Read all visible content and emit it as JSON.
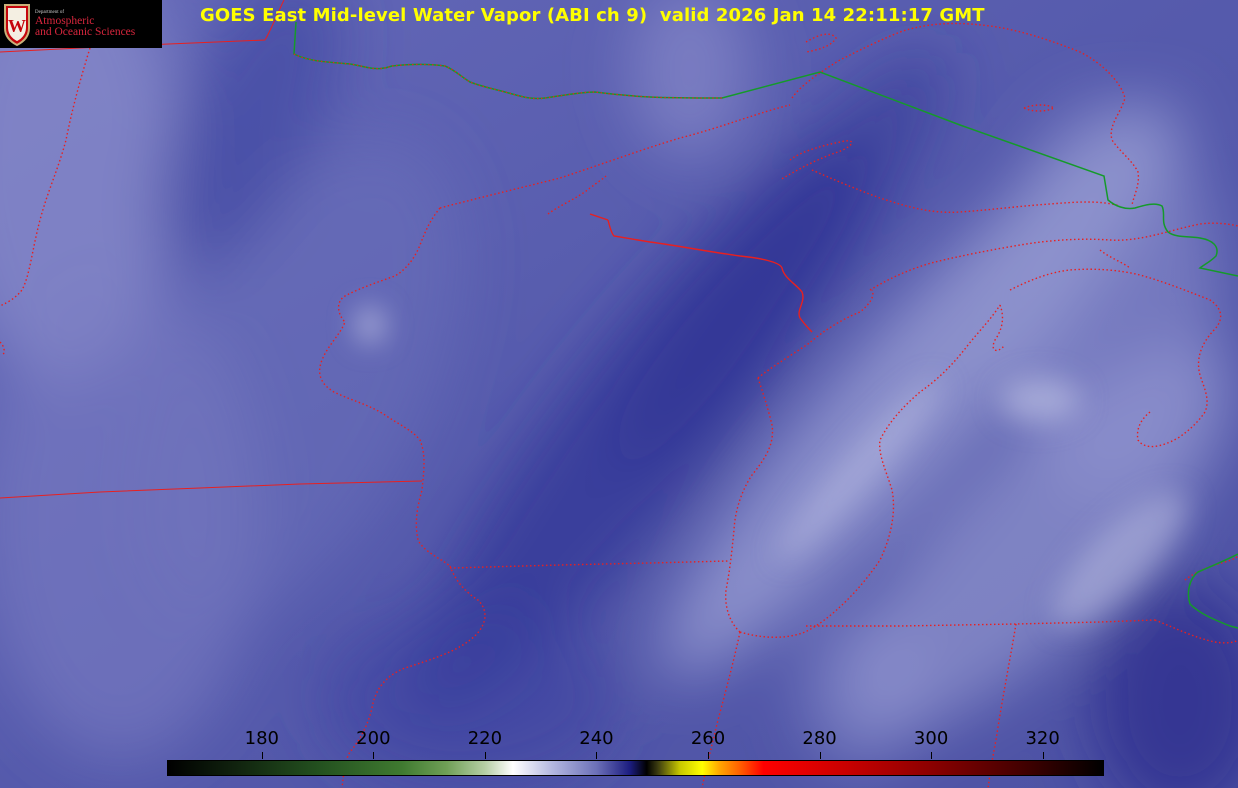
{
  "title": "GOES East Mid-level Water Vapor (ABI ch 9)  valid 2026 Jan 14 22:11:17 GMT",
  "logo": {
    "dept": "Department of",
    "line1": "Atmospheric",
    "line2": "and Oceanic Sciences",
    "crest_letter": "W"
  },
  "colorbar": {
    "ticks": [
      "180",
      "200",
      "220",
      "240",
      "260",
      "280",
      "300",
      "320"
    ],
    "tick_values": [
      180,
      200,
      220,
      240,
      260,
      280,
      300,
      320
    ],
    "min": 163,
    "max": 331,
    "stops": [
      {
        "v": 163,
        "c": "#000000"
      },
      {
        "v": 175,
        "c": "#10220e"
      },
      {
        "v": 190,
        "c": "#23501f"
      },
      {
        "v": 205,
        "c": "#3f7a30"
      },
      {
        "v": 213,
        "c": "#6f9f56"
      },
      {
        "v": 220,
        "c": "#b6cfa6"
      },
      {
        "v": 225,
        "c": "#ffffff"
      },
      {
        "v": 232,
        "c": "#b4b8e0"
      },
      {
        "v": 240,
        "c": "#6c70b8"
      },
      {
        "v": 246,
        "c": "#1c1d80"
      },
      {
        "v": 249,
        "c": "#000000"
      },
      {
        "v": 251,
        "c": "#3b3b10"
      },
      {
        "v": 255,
        "c": "#c8c800"
      },
      {
        "v": 259,
        "c": "#ffff00"
      },
      {
        "v": 262,
        "c": "#ffa800"
      },
      {
        "v": 266,
        "c": "#ff5a00"
      },
      {
        "v": 270,
        "c": "#ff0000"
      },
      {
        "v": 285,
        "c": "#c80000"
      },
      {
        "v": 300,
        "c": "#8c0000"
      },
      {
        "v": 318,
        "c": "#3c0000"
      },
      {
        "v": 331,
        "c": "#000000"
      }
    ]
  },
  "colors": {
    "background": "#4f55a6",
    "state_border": "#e82020",
    "intl_border": "#159a2a",
    "title": "#ffff00"
  }
}
